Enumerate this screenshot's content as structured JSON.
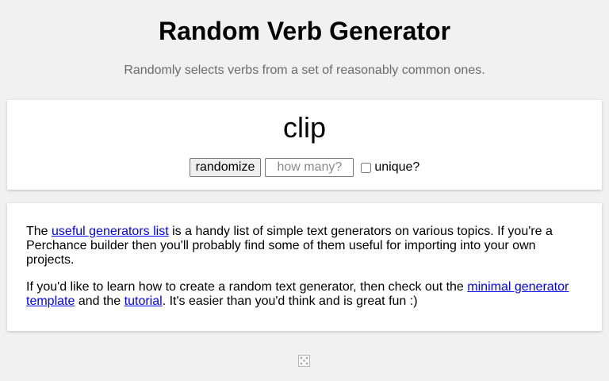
{
  "header": {
    "title": "Random Verb Generator",
    "subtitle": "Randomly selects verbs from a set of reasonably common ones."
  },
  "generator": {
    "output": "clip",
    "randomize_label": "randomize",
    "count_placeholder": "how many?",
    "count_value": "",
    "unique_label": "unique?",
    "unique_checked": false
  },
  "info": {
    "p1_before": "The ",
    "p1_link": "useful generators list",
    "p1_after": " is a handy list of simple text generators on various topics. If you're a Perchance builder then you'll probably find some of them useful for importing into your own projects.",
    "p2_before": "If you'd like to learn how to create a random text generator, then check out the ",
    "p2_link1": "minimal generator template",
    "p2_mid": " and the ",
    "p2_link2": "tutorial",
    "p2_after": ". It's easier than you'd think and is great fun :)"
  },
  "footer": {
    "icon": "dice-icon"
  }
}
